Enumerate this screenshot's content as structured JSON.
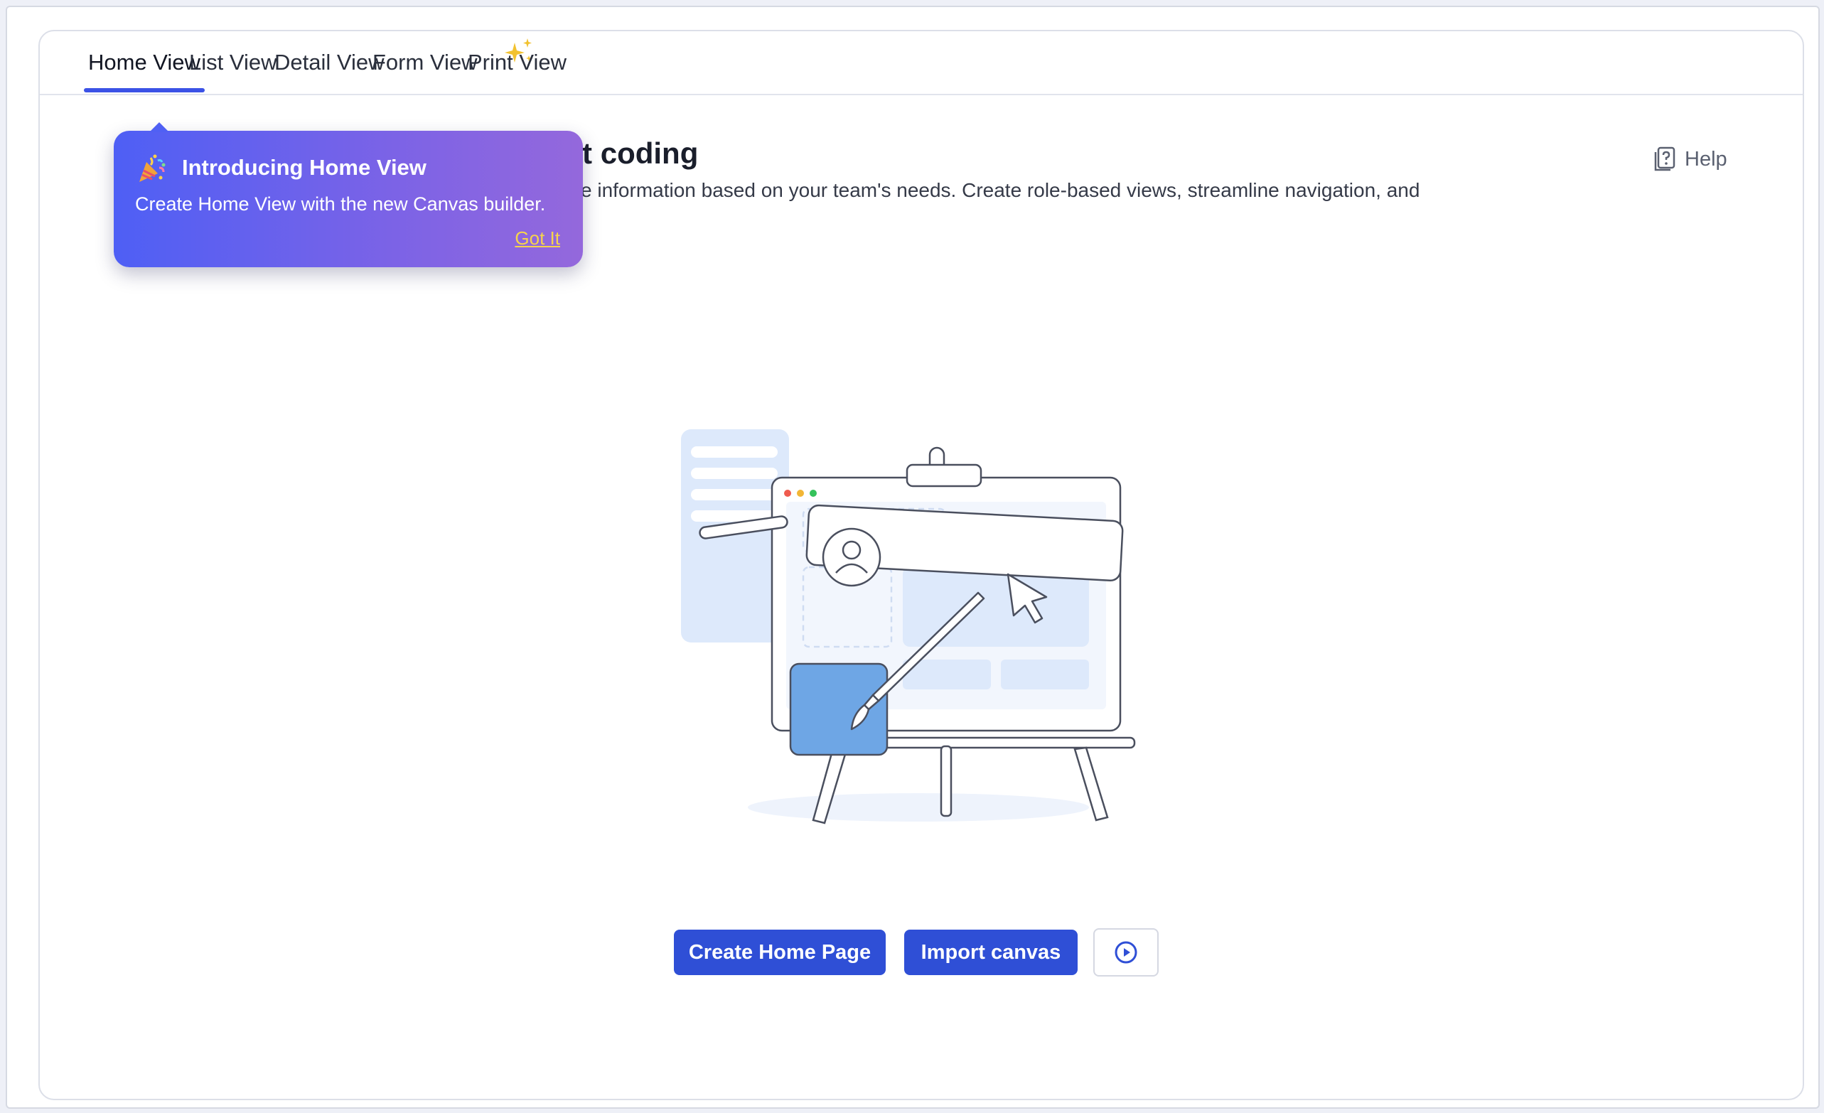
{
  "tabs": [
    {
      "label": "Home View",
      "active": true
    },
    {
      "label": "List View",
      "active": false
    },
    {
      "label": "Detail View",
      "active": false,
      "badge": "sparkle-icon"
    },
    {
      "label": "Form View",
      "active": false
    },
    {
      "label": "Print View",
      "active": false
    }
  ],
  "header": {
    "title": "Design your home page without coding",
    "visible_title": "page without coding",
    "description": "rganize widgets, and structure information based on your team's needs. Create role-based views, streamline navigation, and",
    "help_label": "Help"
  },
  "tooltip": {
    "icon": "party-popper-icon",
    "title": "Introducing Home View",
    "text": "Create Home View with the new Canvas builder.",
    "link": "Got It"
  },
  "actions": {
    "create_label": "Create Home Page",
    "import_label": "Import canvas",
    "play_icon": "play-circle-icon"
  },
  "colors": {
    "accent": "#2f4fd6",
    "tab_underline": "#3b52e6",
    "tooltip_start": "#4e5ff5",
    "tooltip_end": "#9468dc",
    "link": "#f6d34b",
    "illustration_fill": "#dde9fb",
    "illustration_square": "#6ea6e5"
  }
}
